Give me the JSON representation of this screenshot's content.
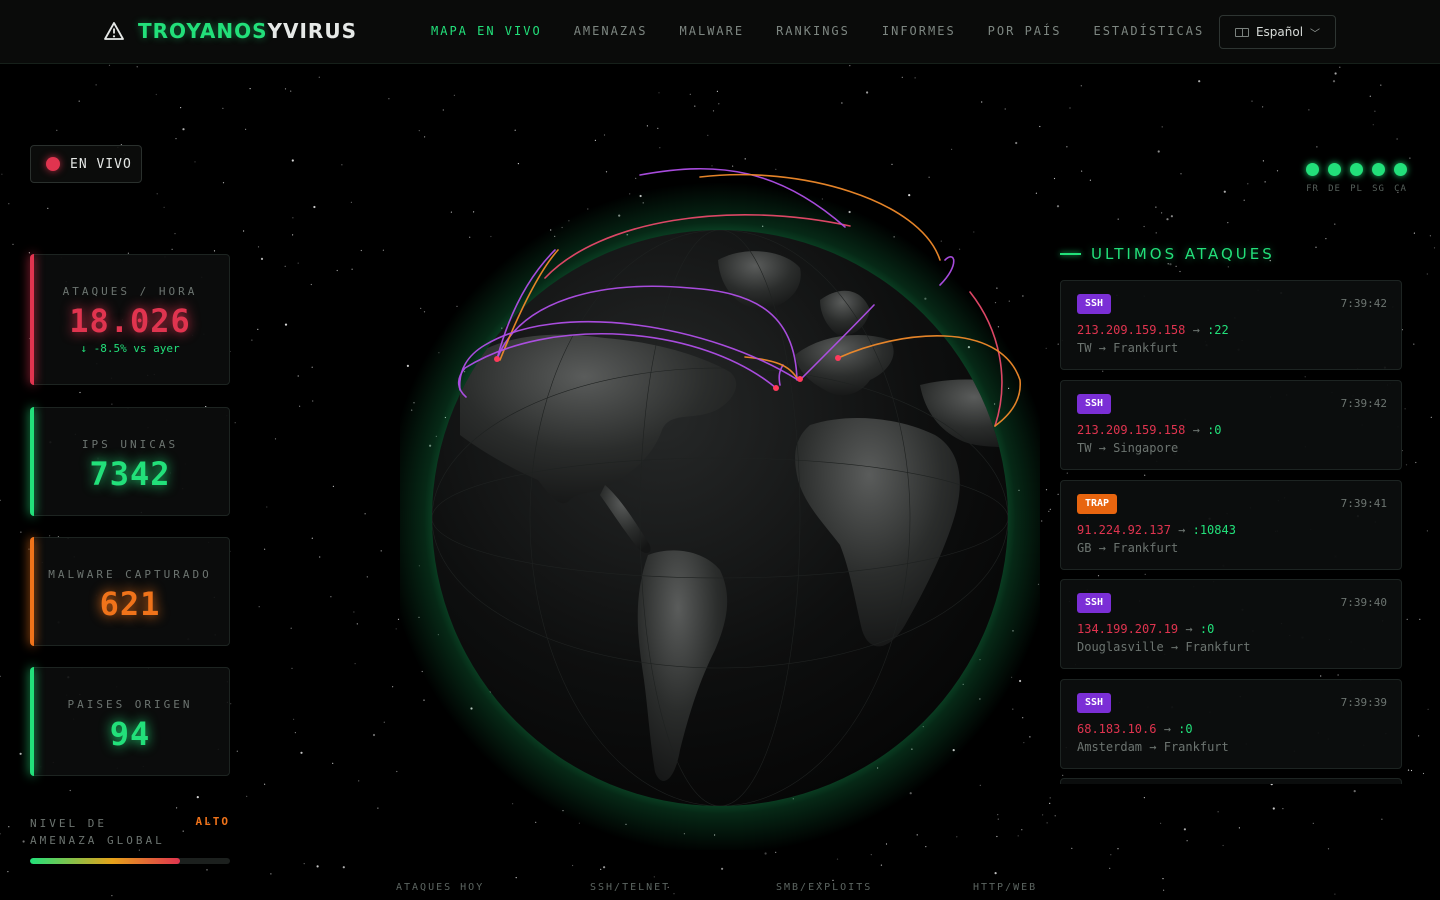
{
  "header": {
    "brand_part1": "TROYANOS",
    "brand_part2": "YVIRUS",
    "nav": [
      "MAPA EN VIVO",
      "AMENAZAS",
      "MALWARE",
      "RANKINGS",
      "INFORMES",
      "POR PAÍS",
      "ESTADÍSTICAS"
    ],
    "nav_active_index": 0,
    "language": "Español"
  },
  "live_badge": "EN VIVO",
  "stats": {
    "attacks_per_hour": {
      "label": "ATAQUES / HORA",
      "value": "18.026",
      "change": "↓ -8.5% vs ayer"
    },
    "unique_ips": {
      "label": "IPS UNICAS",
      "value": "7342"
    },
    "malware_captured": {
      "label": "MALWARE CAPTURADO",
      "value": "621"
    },
    "origin_countries": {
      "label": "PAISES ORIGEN",
      "value": "94"
    }
  },
  "threat_level": {
    "label": "NIVEL DE AMENAZA GLOBAL",
    "value": "ALTO",
    "fill_fraction": 0.75
  },
  "country_indicators": [
    "FR",
    "DE",
    "PL",
    "SG",
    "CA"
  ],
  "attacks_panel": {
    "title": "ULTIMOS ATAQUES",
    "items": [
      {
        "type": "SSH",
        "time": "7:39:42",
        "ip": "213.209.159.158",
        "port": ":22",
        "origin": "TW",
        "target": "Frankfurt"
      },
      {
        "type": "SSH",
        "time": "7:39:42",
        "ip": "213.209.159.158",
        "port": ":0",
        "origin": "TW",
        "target": "Singapore"
      },
      {
        "type": "TRAP",
        "time": "7:39:41",
        "ip": "91.224.92.137",
        "port": ":10843",
        "origin": "GB",
        "target": "Frankfurt"
      },
      {
        "type": "SSH",
        "time": "7:39:40",
        "ip": "134.199.207.19",
        "port": ":0",
        "origin": "Douglasville",
        "target": "Frankfurt"
      },
      {
        "type": "SSH",
        "time": "7:39:39",
        "ip": "68.183.10.6",
        "port": ":0",
        "origin": "Amsterdam",
        "target": "Frankfurt"
      }
    ]
  },
  "bottom_labels": [
    "ATAQUES HOY",
    "SSH/TELNET",
    "SMB/EXPLOITS",
    "HTTP/WEB"
  ],
  "colors": {
    "green": "#22e07a",
    "red": "#e0344f",
    "orange": "#f0731a",
    "purple": "#8a2be2",
    "ssh_tag": "#7b2fd6",
    "trap_tag": "#e8650f"
  }
}
